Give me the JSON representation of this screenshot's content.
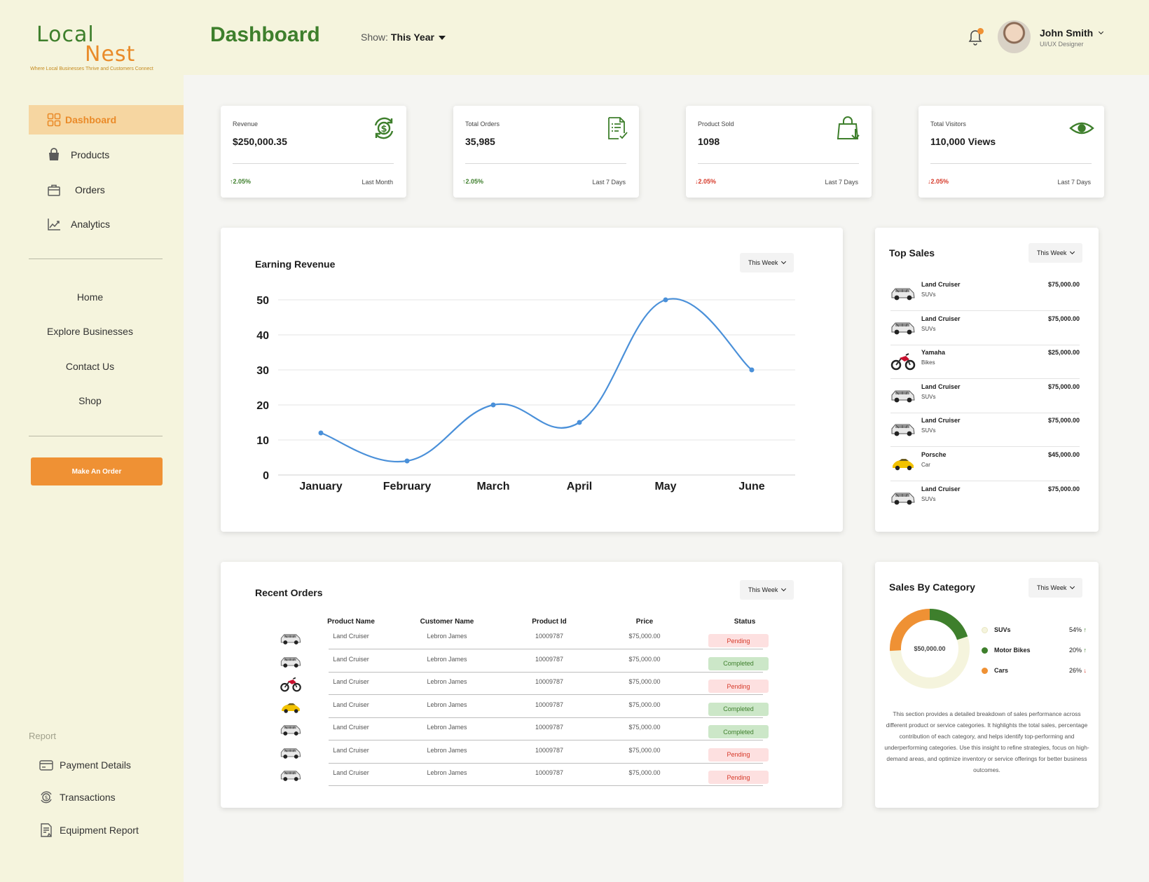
{
  "brand": {
    "word1": "Local",
    "word2": "Nest",
    "tagline": "Where Local Businesses Thrive and Customers Connect",
    "accent_green": "#3e7f2c",
    "accent_orange": "#ef9134"
  },
  "sidebar": {
    "nav": [
      {
        "label": "Dashboard",
        "icon": "grid-icon",
        "active": true
      },
      {
        "label": "Products",
        "icon": "bag-icon"
      },
      {
        "label": "Orders",
        "icon": "briefcase-icon"
      },
      {
        "label": "Analytics",
        "icon": "chart-line-icon"
      }
    ],
    "links": [
      "Home",
      "Explore Businesses",
      "Contact Us",
      "Shop"
    ],
    "cta": "Make An Order",
    "report_label": "Report",
    "report_items": [
      {
        "label": "Payment Details",
        "icon": "card-icon"
      },
      {
        "label": "Transactions",
        "icon": "dollar-cycle-icon"
      },
      {
        "label": "Equipment Report",
        "icon": "report-icon"
      }
    ]
  },
  "header": {
    "title": "Dashboard",
    "show_label": "Show:",
    "show_value": "This Year",
    "user_name": "John Smith",
    "user_role": "UI/UX Designer"
  },
  "stats": [
    {
      "label": "Revenue",
      "value": "$250,000.35",
      "change": "2.05%",
      "direction": "up",
      "period": "Last Month",
      "icon": "dollar-cycle-icon"
    },
    {
      "label": "Total Orders",
      "value": "35,985",
      "change": "2.05%",
      "direction": "up",
      "period": "Last 7 Days",
      "icon": "document-check-icon"
    },
    {
      "label": "Product Sold",
      "value": "1098",
      "change": "2.05%",
      "direction": "down",
      "period": "Last 7 Days",
      "icon": "shopping-bag-icon"
    },
    {
      "label": "Total Visitors",
      "value": "110,000 Views",
      "change": "2.05%",
      "direction": "down",
      "period": "Last 7 Days",
      "icon": "eye-icon"
    }
  ],
  "earning": {
    "title": "Earning Revenue",
    "filter": "This Week"
  },
  "chart_data": {
    "type": "line",
    "title": "Earning Revenue",
    "categories": [
      "January",
      "February",
      "March",
      "April",
      "May",
      "June"
    ],
    "series": [
      {
        "values": [
          12,
          4,
          20,
          15,
          50,
          30
        ]
      }
    ],
    "ylim": [
      0,
      50
    ],
    "yticks": [
      0,
      10,
      20,
      30,
      40,
      50
    ],
    "grid": true,
    "color": "#4a90d9"
  },
  "top_sales": {
    "title": "Top Sales",
    "filter": "This Week",
    "items": [
      {
        "name": "Land Cruiser",
        "category": "SUVs",
        "price": "$75,000.00",
        "kind": "suv"
      },
      {
        "name": "Land Cruiser",
        "category": "SUVs",
        "price": "$75,000.00",
        "kind": "suv"
      },
      {
        "name": "Yamaha",
        "category": "Bikes",
        "price": "$25,000.00",
        "kind": "bike"
      },
      {
        "name": "Land Cruiser",
        "category": "SUVs",
        "price": "$75,000.00",
        "kind": "suv"
      },
      {
        "name": "Land Cruiser",
        "category": "SUVs",
        "price": "$75,000.00",
        "kind": "suv"
      },
      {
        "name": "Porsche",
        "category": "Car",
        "price": "$45,000.00",
        "kind": "car"
      },
      {
        "name": "Land Cruiser",
        "category": "SUVs",
        "price": "$75,000.00",
        "kind": "suv"
      }
    ]
  },
  "orders": {
    "title": "Recent Orders",
    "filter": "This Week",
    "columns": [
      "Product Name",
      "Customer Name",
      "Product Id",
      "Price",
      "Status"
    ],
    "rows": [
      {
        "product": "Land Cruiser",
        "customer": "Lebron James",
        "id": "10009787",
        "price": "$75,000.00",
        "status": "Pending",
        "kind": "suv"
      },
      {
        "product": "Land Cruiser",
        "customer": "Lebron James",
        "id": "10009787",
        "price": "$75,000.00",
        "status": "Completed",
        "kind": "suv"
      },
      {
        "product": "Land Cruiser",
        "customer": "Lebron James",
        "id": "10009787",
        "price": "$75,000.00",
        "status": "Pending",
        "kind": "bike"
      },
      {
        "product": "Land Cruiser",
        "customer": "Lebron James",
        "id": "10009787",
        "price": "$75,000.00",
        "status": "Completed",
        "kind": "car"
      },
      {
        "product": "Land Cruiser",
        "customer": "Lebron James",
        "id": "10009787",
        "price": "$75,000.00",
        "status": "Completed",
        "kind": "suv"
      },
      {
        "product": "Land Cruiser",
        "customer": "Lebron James",
        "id": "10009787",
        "price": "$75,000.00",
        "status": "Pending",
        "kind": "suv"
      },
      {
        "product": "Land Cruiser",
        "customer": "Lebron James",
        "id": "10009787",
        "price": "$75,000.00",
        "status": "Pending",
        "kind": "suv"
      }
    ]
  },
  "category": {
    "title": "Sales By Category",
    "filter": "This Week",
    "center": "$50,000.00",
    "items": [
      {
        "name": "SUVs",
        "pct": "54%",
        "share": 54,
        "direction": "up",
        "color": "#f5f4dd"
      },
      {
        "name": "Motor Bikes",
        "pct": "20%",
        "share": 20,
        "direction": "up",
        "color": "#3e7f2c"
      },
      {
        "name": "Cars",
        "pct": "26%",
        "share": 26,
        "direction": "down",
        "color": "#ef9134"
      }
    ],
    "description": "This section provides a detailed breakdown of sales performance across different product or service categories. It highlights the total sales, percentage contribution of each category, and helps identify top-performing and underperforming categories. Use this insight to refine strategies, focus on high-demand areas, and optimize inventory or service offerings for better business outcomes."
  }
}
